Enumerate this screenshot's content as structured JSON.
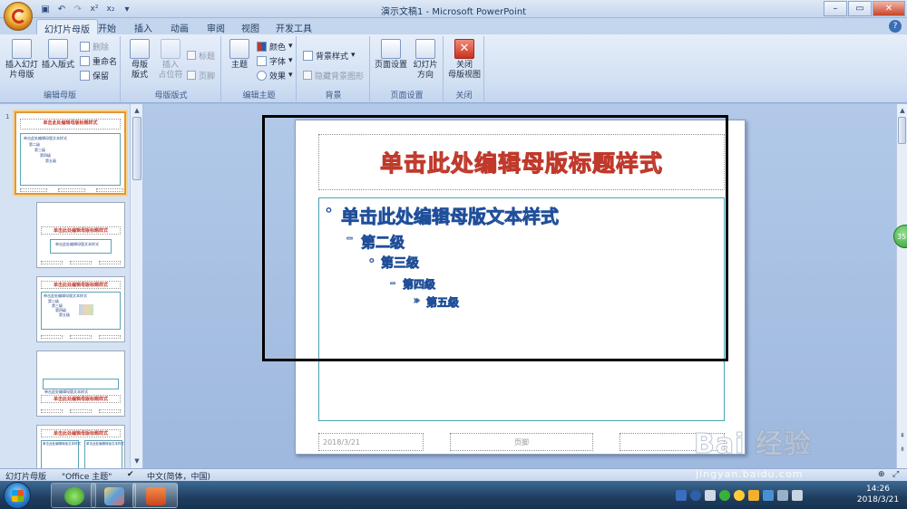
{
  "window": {
    "title": "演示文稿1 - Microsoft PowerPoint"
  },
  "tabs": [
    {
      "label": "幻灯片母版",
      "active": true
    },
    {
      "label": "开始"
    },
    {
      "label": "插入"
    },
    {
      "label": "动画"
    },
    {
      "label": "审阅"
    },
    {
      "label": "视图"
    },
    {
      "label": "开发工具"
    }
  ],
  "ribbon": {
    "edit_master": {
      "label": "编辑母版",
      "insert_master_line1": "插入幻灯",
      "insert_master_line2": "片母版",
      "insert_layout": "插入版式",
      "delete": "删除",
      "rename": "重命名",
      "preserve": "保留"
    },
    "master_layout": {
      "label": "母版版式",
      "master_layout_line1": "母版",
      "master_layout_line2": "版式",
      "insert_placeholder_line1": "插入",
      "insert_placeholder_line2": "占位符",
      "title_check": "标题",
      "footer_check": "页脚"
    },
    "edit_theme": {
      "label": "编辑主题",
      "themes": "主题",
      "colors": "颜色",
      "fonts": "字体",
      "effects": "效果"
    },
    "background": {
      "label": "背景",
      "styles": "背景样式",
      "hide": "隐藏背景图形"
    },
    "page_setup": {
      "label": "页面设置",
      "page_setup": "页面设置",
      "orientation_line1": "幻灯片",
      "orientation_line2": "方向"
    },
    "close": {
      "label": "关闭",
      "close_line1": "关闭",
      "close_line2": "母版视图"
    }
  },
  "thumbnails": {
    "first_number": "1",
    "master_title": "单击此处编辑母版标题样式",
    "master_body": "单击此处编辑母版文本样式",
    "level2": "第二级",
    "level3": "第三级",
    "level4": "第四级",
    "level5": "第五级"
  },
  "slide": {
    "title": "单击此处编辑母版标题样式",
    "level1": "单击此处编辑母版文本样式",
    "level2": "第二级",
    "level3": "第三级",
    "level4": "第四级",
    "level5": "第五级",
    "date": "2018/3/21",
    "footer": "页脚"
  },
  "status": {
    "view": "幻灯片母版",
    "theme": "\"Office 主题\"",
    "language": "中文(简体，中国)"
  },
  "badge": {
    "value": "35"
  },
  "watermark": {
    "main": "Bai 经验",
    "sub": "jingyan.baidu.com"
  },
  "clock": {
    "time": "14:26",
    "date": "2018/3/21"
  }
}
